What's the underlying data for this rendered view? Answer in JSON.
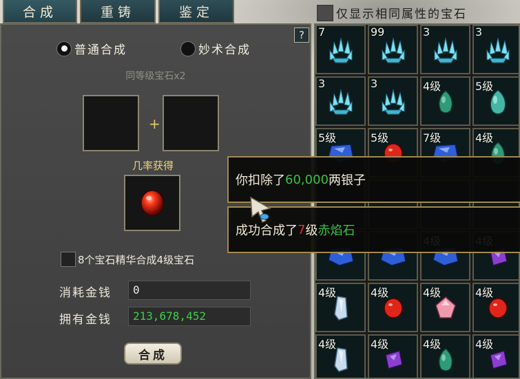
{
  "tabs": [
    {
      "label": "合成"
    },
    {
      "label": "重铸"
    },
    {
      "label": "鉴定"
    }
  ],
  "left": {
    "help": "?",
    "radio_normal": "普通合成",
    "radio_special": "妙术合成",
    "requirement": "同等级宝石x2",
    "plus": "+",
    "probability_label": "几率获得",
    "essence_option": "8个宝石精华合成4级宝石",
    "cost_label": "消耗金钱",
    "cost_value": "0",
    "owned_label": "拥有金钱",
    "owned_value": "213,678,452",
    "combine_button": "合成"
  },
  "right": {
    "filter_label": "仅显示相同属性的宝石",
    "grid": [
      [
        "7",
        "99",
        "3",
        "3"
      ],
      [
        "3",
        "3",
        "4级",
        "5级"
      ],
      [
        "5级",
        "5级",
        "7级",
        "4级"
      ],
      [
        "",
        "",
        "",
        ""
      ],
      [
        "",
        "",
        "4级",
        "4级"
      ],
      [
        "4级",
        "4级",
        "4级",
        "4级"
      ],
      [
        "4级",
        "4级",
        "4级",
        "4级"
      ]
    ],
    "grid_gems": [
      [
        "crystal",
        "crystal",
        "crystal",
        "crystal"
      ],
      [
        "crystal",
        "crystal",
        "green",
        "teal"
      ],
      [
        "sapphire",
        "ruby",
        "sapphire",
        "green"
      ],
      [
        "",
        "",
        "",
        ""
      ],
      [
        "sapphire",
        "sapphire",
        "sapphire",
        "amethyst"
      ],
      [
        "quartz",
        "ruby",
        "pink",
        "ruby"
      ],
      [
        "quartz",
        "amethyst",
        "green",
        "amethyst"
      ]
    ]
  },
  "messages": {
    "line1_prefix": "你扣除了",
    "line1_amount": "60,000",
    "line1_suffix": "两银子",
    "line2_prefix": "成功合成了",
    "line2_level": "7",
    "line2_mid": "级",
    "line2_gem": "赤焰石"
  },
  "colors": {
    "green": "#36c24a",
    "red": "#e03030",
    "gold": "#f2d27a"
  }
}
